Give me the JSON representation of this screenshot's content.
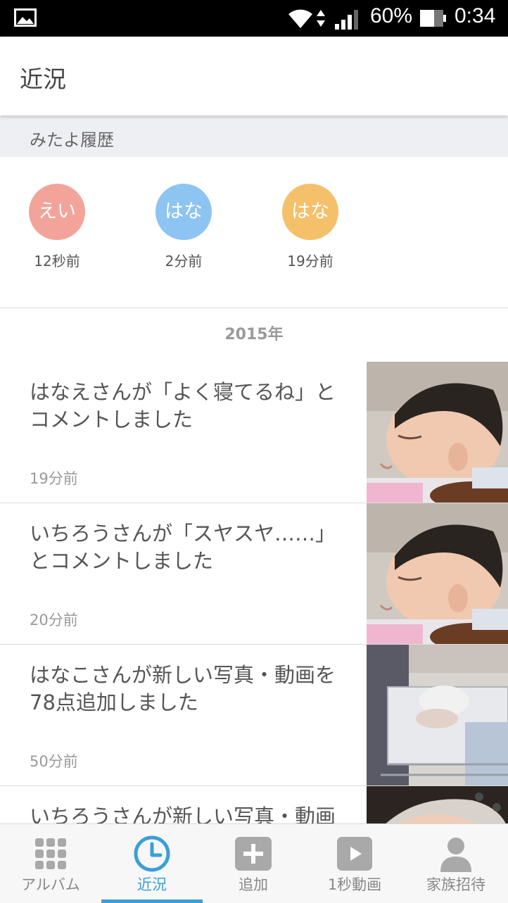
{
  "status_bar": {
    "battery_percent": "60%",
    "time": "0:34",
    "icons": [
      "image-icon",
      "wifi-icon",
      "data-arrows-icon",
      "signal-icon",
      "battery-icon"
    ]
  },
  "app_bar": {
    "title": "近況"
  },
  "viewed_history": {
    "header": "みたよ履歴",
    "viewers": [
      {
        "name": "えい",
        "time": "12秒前",
        "color": "#f2a49b"
      },
      {
        "name": "はな",
        "time": "2分前",
        "color": "#8ec4f2"
      },
      {
        "name": "はな",
        "time": "19分前",
        "color": "#f5c06a"
      }
    ]
  },
  "year_label": "2015年",
  "feed": [
    {
      "text": "はなえさんが「よく寝てるね」とコメントしました",
      "time": "19分前",
      "thumb": "sleeping-baby-photo"
    },
    {
      "text": "いちろうさんが「スヤスヤ……」とコメントしました",
      "time": "20分前",
      "thumb": "sleeping-baby-photo"
    },
    {
      "text": "はなこさんが新しい写真・動画を78点追加しました",
      "time": "50分前",
      "thumb": "newborn-bassinet-photo"
    },
    {
      "text": "いちろうさんが新しい写真・動画",
      "time": "",
      "thumb": "baby-photo"
    }
  ],
  "bottom_nav": {
    "items": [
      {
        "label": "アルバム",
        "icon": "grid-icon",
        "active": false
      },
      {
        "label": "近況",
        "icon": "clock-icon",
        "active": true
      },
      {
        "label": "追加",
        "icon": "plus-icon",
        "active": false
      },
      {
        "label": "1秒動画",
        "icon": "play-icon",
        "active": false
      },
      {
        "label": "家族招待",
        "icon": "person-icon",
        "active": false
      }
    ]
  },
  "colors": {
    "accent": "#3a9fd8",
    "section_bg": "#eeeff2",
    "nav_icon_gray": "#a9a9a9"
  }
}
